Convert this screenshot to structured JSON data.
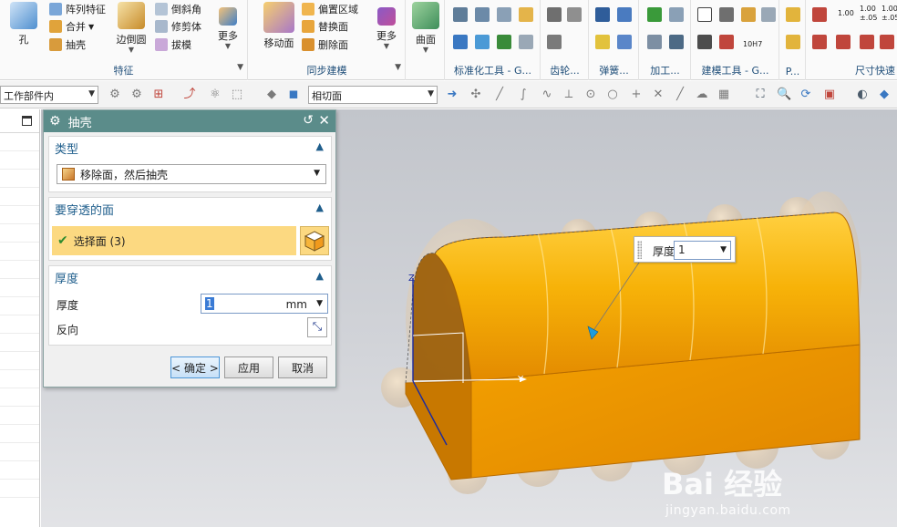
{
  "ribbon": {
    "feature_group": {
      "label": "特征",
      "hole": "孔",
      "pattern_feature": "阵列特征",
      "unite": "合并",
      "shell": "抽壳",
      "edge_blend": "边倒圆",
      "chamfer": "倒斜角",
      "trim_body": "修剪体",
      "draft": "拔模",
      "more": "更多"
    },
    "sync_group": {
      "label": "同步建模",
      "move_face": "移动面",
      "offset_region": "偏置区域",
      "replace_face": "替换面",
      "delete_face": "删除面",
      "more": "更多"
    },
    "surface_group": {
      "surface": "曲面"
    },
    "right_groups": [
      {
        "label": "标准化工具 - G..."
      },
      {
        "label": "齿轮..."
      },
      {
        "label": "弹簧..."
      },
      {
        "label": "加工..."
      },
      {
        "label": "建模工具 - G..."
      },
      {
        "label": "P..."
      },
      {
        "label": "尺寸快速"
      }
    ],
    "dim_labels": [
      "1.00",
      "1.00",
      "1.00"
    ],
    "dim_sub_labels": [
      "±.05",
      "±.05"
    ],
    "tol_label": "10H7"
  },
  "selection_bar": {
    "scope": "工作部件内",
    "rule": "相切面"
  },
  "dialog": {
    "title": "抽壳",
    "type_section": {
      "title": "类型",
      "value": "移除面，然后抽壳"
    },
    "faces_section": {
      "title": "要穿透的面",
      "select_label": "选择面 (3)"
    },
    "thickness_section": {
      "title": "厚度",
      "thickness_label": "厚度",
      "thickness_value": "1",
      "unit": "mm",
      "reverse_label": "反向"
    },
    "buttons": {
      "ok": "< 确定 >",
      "apply": "应用",
      "cancel": "取消"
    }
  },
  "screen_input": {
    "label": "厚度",
    "value": "1"
  },
  "axes": {
    "y": "Y",
    "z": "Z"
  },
  "watermark": {
    "logo": "Bai 经验",
    "url": "jingyan.baidu.com"
  },
  "colors": {
    "title_bar": "#5b8c8a",
    "highlight": "#fcd981",
    "body": "#f5a300",
    "section_title": "#1f5e8c"
  }
}
